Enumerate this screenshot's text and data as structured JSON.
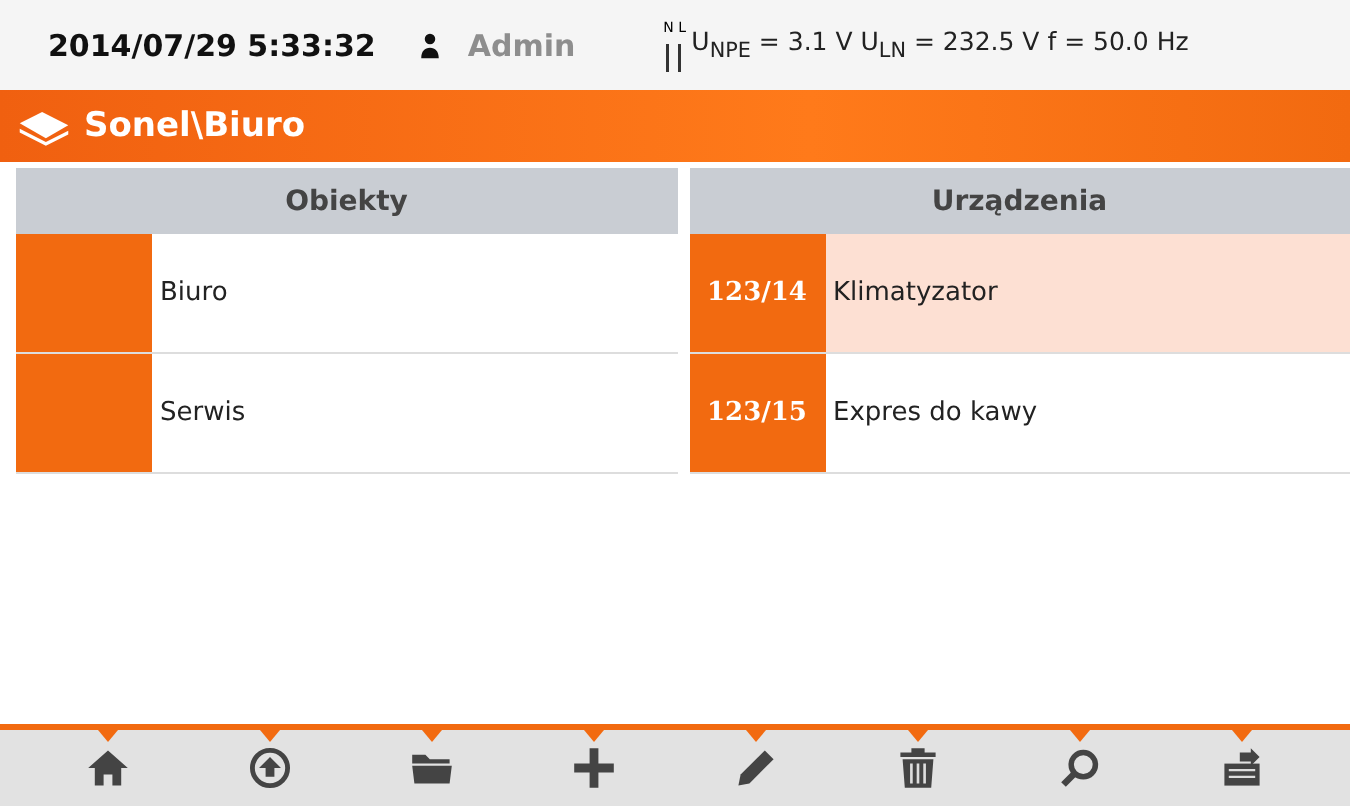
{
  "status_bar": {
    "datetime": "2014/07/29 5:33:32",
    "user": "Admin",
    "user_active": false,
    "phase_labels": [
      "N",
      "L"
    ],
    "readings": "U$_{NPE}$ = 3.1 V U$_{LN}$ = 232.5 V f = 50.0 Hz"
  },
  "header": {
    "path": "Sonel\\Biuro"
  },
  "panels": [
    {
      "title": "Obiekty",
      "rows": [
        {
          "code": "",
          "name": "Biuro",
          "selected": false
        },
        {
          "code": "",
          "name": "Serwis",
          "selected": false
        }
      ]
    },
    {
      "title": "Urządzenia",
      "rows": [
        {
          "code": "123/14",
          "name": "Klimatyzator",
          "selected": true
        },
        {
          "code": "123/15",
          "name": "Expres do kawy",
          "selected": false
        }
      ]
    }
  ],
  "toolbar": [
    {
      "kind": "home"
    },
    {
      "kind": "up"
    },
    {
      "kind": "folder"
    },
    {
      "kind": "add"
    },
    {
      "kind": "edit"
    },
    {
      "kind": "delete"
    },
    {
      "kind": "search"
    },
    {
      "kind": "export"
    }
  ]
}
